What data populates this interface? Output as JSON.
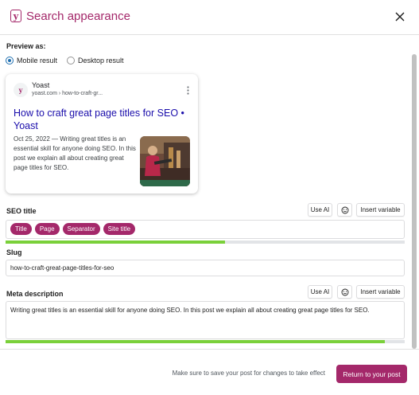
{
  "header": {
    "title": "Search appearance",
    "logo_letter": "y"
  },
  "preview": {
    "label": "Preview as:",
    "options": [
      {
        "label": "Mobile result",
        "selected": true
      },
      {
        "label": "Desktop result",
        "selected": false
      }
    ]
  },
  "google_card": {
    "site_name": "Yoast",
    "url": "yoast.com › how-to-craft-gr...",
    "title": "How to craft great page titles for SEO • Yoast",
    "description": "Oct 25, 2022 — Writing great titles is an essential skill for anyone doing SEO. In this post we explain all about creating great page titles for SEO.",
    "favicon_letter": "y"
  },
  "seo_title": {
    "label": "SEO title",
    "use_ai": "Use AI",
    "insert_variable": "Insert variable",
    "chips": [
      "Title",
      "Page",
      "Separator",
      "Site title"
    ],
    "progress_fraction": 0.55
  },
  "slug": {
    "label": "Slug",
    "value": "how-to-craft-great-page-titles-for-seo"
  },
  "meta_description": {
    "label": "Meta description",
    "use_ai": "Use AI",
    "insert_variable": "Insert variable",
    "value": "Writing great titles is an essential skill for anyone doing SEO. In this post we explain all about creating great page titles for SEO.",
    "progress_fraction": 0.95
  },
  "footer": {
    "note": "Make sure to save your post for changes to take effect",
    "return_button": "Return to your post"
  },
  "colors": {
    "brand": "#a4286a",
    "link": "#1a0dab",
    "progress_good": "#7ad03a",
    "radio_accent": "#2271b1"
  },
  "icons": [
    "close-icon",
    "emoji-icon",
    "kebab-menu-icon",
    "yoast-logo-icon"
  ]
}
